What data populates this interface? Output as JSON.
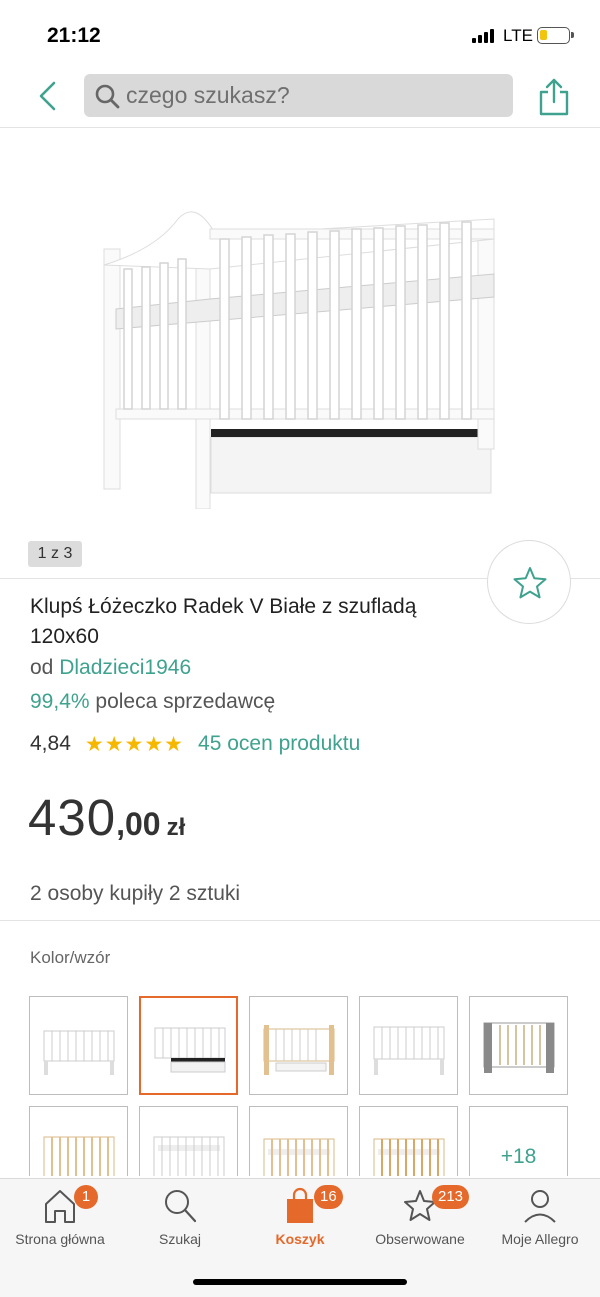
{
  "status": {
    "time": "21:12",
    "network": "LTE"
  },
  "header": {
    "search_placeholder": "czego szukasz?"
  },
  "gallery": {
    "counter": "1 z 3"
  },
  "product": {
    "title": "Klupś Łóżeczko Radek V Białe z szufladą 120x60",
    "seller_prefix": "od",
    "seller_name": "Dladzieci1946",
    "recommend_pct": "99,4%",
    "recommend_text": "poleca sprzedawcę",
    "rating_value": "4,84",
    "rating_stars": "★★★★★",
    "rating_count": "45 ocen produktu",
    "stars_out_of_5": 4.84,
    "price_int": "430",
    "price_dec": ",00",
    "price_currency": "zł",
    "bought_text": "2 osoby kupiły 2 sztuki"
  },
  "variants": {
    "label": "Kolor/wzór",
    "more_label": "+18",
    "items": [
      {
        "name": "white-crib",
        "selected": false
      },
      {
        "name": "white-crib-drawer",
        "selected": true
      },
      {
        "name": "white-natural-crib",
        "selected": false
      },
      {
        "name": "white-crib-2",
        "selected": false
      },
      {
        "name": "grey-crib",
        "selected": false
      },
      {
        "name": "natural-crib",
        "selected": false
      },
      {
        "name": "white-crib-3",
        "selected": false
      },
      {
        "name": "natural-crib-2",
        "selected": false
      },
      {
        "name": "natural-crib-3",
        "selected": false
      }
    ]
  },
  "tabbar": {
    "home": {
      "label": "Strona główna",
      "badge": "1"
    },
    "search": {
      "label": "Szukaj"
    },
    "cart": {
      "label": "Koszyk",
      "badge": "16"
    },
    "watched": {
      "label": "Obserwowane",
      "badge": "213"
    },
    "account": {
      "label": "Moje Allegro"
    }
  },
  "colors": {
    "accent": "#3fa28f",
    "orange": "#e4692a",
    "star": "#f5b700"
  }
}
